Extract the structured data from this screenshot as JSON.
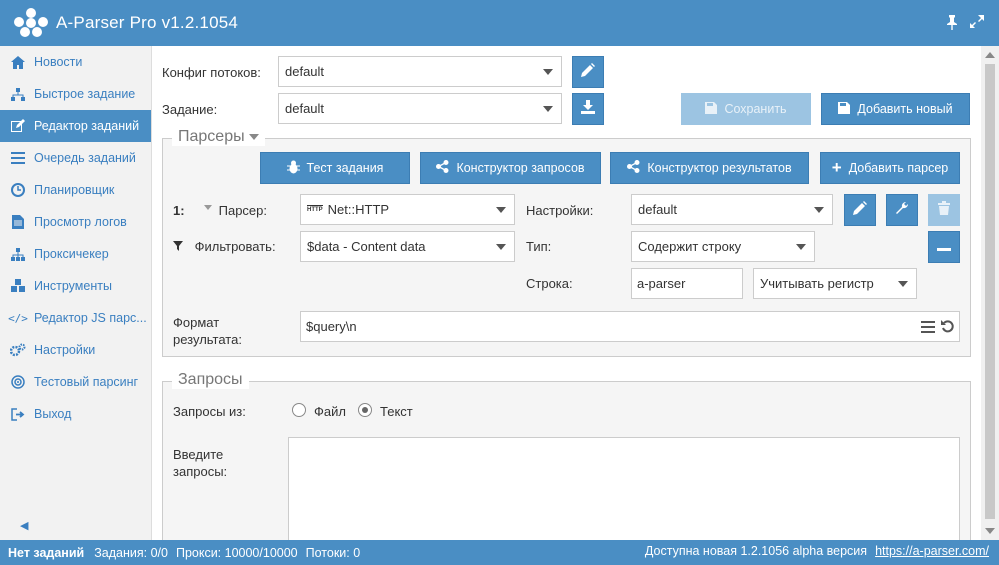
{
  "app": {
    "title": "A-Parser Pro v1.2.1054"
  },
  "sidebar": {
    "items": [
      {
        "label": "Новости",
        "icon": "home-icon"
      },
      {
        "label": "Быстрое задание",
        "icon": "sitemap-icon"
      },
      {
        "label": "Редактор заданий",
        "icon": "edit-icon",
        "active": true
      },
      {
        "label": "Очередь заданий",
        "icon": "list-icon"
      },
      {
        "label": "Планировщик",
        "icon": "clock-icon"
      },
      {
        "label": "Просмотр логов",
        "icon": "file-icon"
      },
      {
        "label": "Проксичекер",
        "icon": "sitemap-icon"
      },
      {
        "label": "Инструменты",
        "icon": "cubes-icon"
      },
      {
        "label": "Редактор JS парс...",
        "icon": "code-icon"
      },
      {
        "label": "Настройки",
        "icon": "gears-icon"
      },
      {
        "label": "Тестовый парсинг",
        "icon": "target-icon"
      },
      {
        "label": "Выход",
        "icon": "sign-out-icon"
      }
    ]
  },
  "config": {
    "threads_label": "Конфиг потоков:",
    "threads_value": "default",
    "task_label": "Задание:",
    "task_value": "default",
    "save_label": "Сохранить",
    "add_new_label": "Добавить новый"
  },
  "parsers": {
    "legend": "Парсеры",
    "test_task_label": "Тест задания",
    "query_builder_label": "Конструктор запросов",
    "result_builder_label": "Конструктор результатов",
    "add_parser_label": "Добавить парсер",
    "index": "1:",
    "parser_label": "Парсер:",
    "parser_value": "Net::HTTP",
    "parser_icon_text": "HTTP",
    "settings_label": "Настройки:",
    "settings_value": "default",
    "filter_label": "Фильтровать:",
    "filter_value": "$data - Content data",
    "type_label": "Тип:",
    "type_value": "Содержит строку",
    "string_label": "Строка:",
    "string_value": "a-parser",
    "case_value": "Учитывать регистр",
    "format_label_1": "Формат",
    "format_label_2": "результата:",
    "format_value": "$query\\n"
  },
  "queries": {
    "legend": "Запросы",
    "from_label": "Запросы из:",
    "option_file": "Файл",
    "option_text": "Текст",
    "selected": "Текст",
    "enter_label_1": "Введите",
    "enter_label_2": "запросы:",
    "text_value": ""
  },
  "status": {
    "no_tasks": "Нет заданий",
    "tasks": "Задания: 0/0",
    "proxies": "Прокси: 10000/10000",
    "threads": "Потоки: 0",
    "update_text": "Доступна новая 1.2.1056 alpha версия",
    "update_link": "https://a-parser.com/"
  },
  "colors": {
    "primary": "#4a8ec4",
    "link": "#3a7fc0",
    "disabled": "#9cc4e2"
  }
}
